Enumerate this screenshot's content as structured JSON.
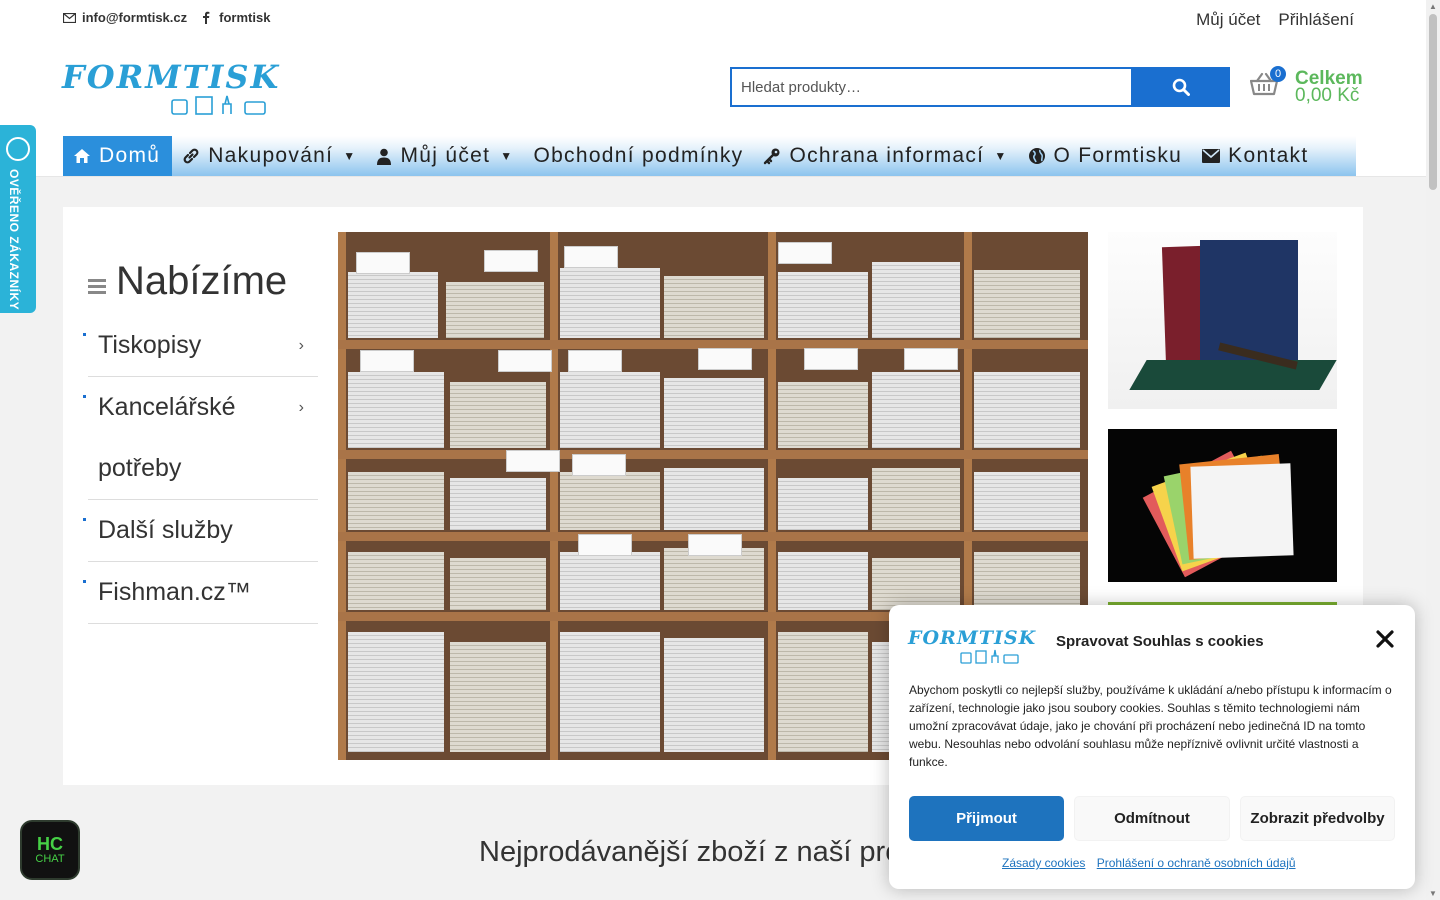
{
  "topbar": {
    "email": "info@formtisk.cz",
    "facebook": "formtisk",
    "account_link": "Můj účet",
    "login_link": "Přihlášení"
  },
  "brand": {
    "logo_text": "FORMTISK",
    "accent": "#1a6fd0",
    "logo_color": "#2a9fd6",
    "green": "#5cb85c"
  },
  "search": {
    "placeholder": "Hledat produkty…"
  },
  "cart": {
    "count": "0",
    "label": "Celkem",
    "total": "0,00 Kč"
  },
  "nav": {
    "items": [
      {
        "label": "Domů",
        "icon": "home-icon"
      },
      {
        "label": "Nakupování",
        "icon": "link-icon"
      },
      {
        "label": "Můj účet",
        "icon": "user-icon"
      },
      {
        "label": "Obchodní podmínky",
        "icon": ""
      },
      {
        "label": "Ochrana informací",
        "icon": "key-icon"
      },
      {
        "label": "O Formtisku",
        "icon": "globe-icon"
      },
      {
        "label": "Kontakt",
        "icon": "envelope-icon"
      }
    ]
  },
  "side_badge": {
    "text": "OVĚŘENO ZÁKAZNÍKY"
  },
  "sidebar": {
    "title": "Nabízíme",
    "items": [
      {
        "label": "Tiskopisy"
      },
      {
        "label": "Kancelářské potřeby"
      },
      {
        "label": "Další služby"
      },
      {
        "label": "Fishman.cz™"
      }
    ]
  },
  "section": {
    "bestsellers_title": "Nejprodávanější zboží z naší prod"
  },
  "chat": {
    "line1": "HC",
    "line2": "CHAT"
  },
  "cookie": {
    "title": "Spravovat Souhlas s cookies",
    "logo_text": "FORMTISK",
    "text": "Abychom poskytli co nejlepší služby, používáme k ukládání a/nebo přístupu k informacím o zařízení, technologie jako jsou soubory cookies. Souhlas s těmito technologiemi nám umožní zpracovávat údaje, jako je chování při procházení nebo jedinečná ID na tomto webu. Nesouhlas nebo odvolání souhlasu může nepříznivě ovlivnit určité vlastnosti a funkce.",
    "accept": "Přijmout",
    "deny": "Odmítnout",
    "prefs": "Zobrazit předvolby",
    "link_cookies": "Zásady cookies",
    "link_privacy": "Prohlášení o ochraně osobních údajů"
  }
}
